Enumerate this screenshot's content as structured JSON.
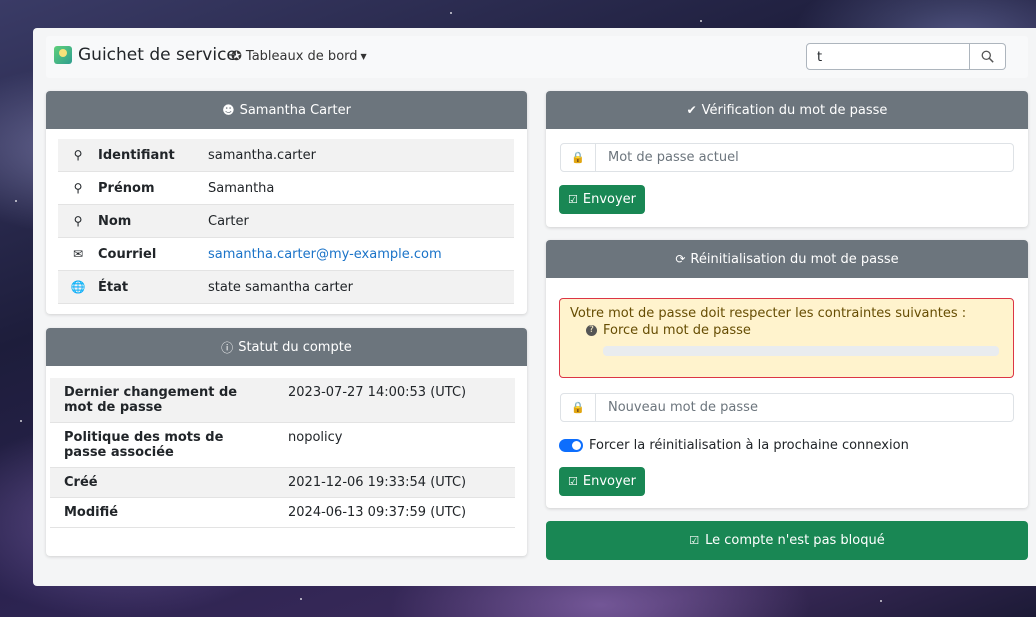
{
  "navbar": {
    "brand": "Guichet de service",
    "dashboard_label": "Tableaux de bord",
    "search_value": "t"
  },
  "user_card": {
    "title": "Samantha Carter",
    "rows": [
      {
        "icon": "user-icon",
        "label": "Identifiant",
        "value": "samantha.carter"
      },
      {
        "icon": "user-icon",
        "label": "Prénom",
        "value": "Samantha"
      },
      {
        "icon": "user-icon",
        "label": "Nom",
        "value": "Carter"
      },
      {
        "icon": "envelope-icon",
        "label": "Courriel",
        "value": "samantha.carter@my-example.com"
      },
      {
        "icon": "globe-icon",
        "label": "État",
        "value": "state samantha carter"
      }
    ]
  },
  "status_card": {
    "title": "Statut du compte",
    "rows": [
      {
        "label": "Dernier changement de mot de passe",
        "value": "2023-07-27 14:00:53 (UTC)"
      },
      {
        "label": "Politique des mots de passe associée",
        "value": "nopolicy"
      },
      {
        "label": "Créé",
        "value": "2021-12-06 19:33:54 (UTC)"
      },
      {
        "label": "Modifié",
        "value": "2024-06-13 09:37:59 (UTC)"
      }
    ]
  },
  "verify_card": {
    "title": "Vérification du mot de passe",
    "placeholder": "Mot de passe actuel",
    "submit_label": "Envoyer"
  },
  "reset_card": {
    "title": "Réinitialisation du mot de passe",
    "warning_text": "Votre mot de passe doit respecter les contraintes suivantes :",
    "rule_label": "Force du mot de passe",
    "strength_fraction": 0,
    "placeholder": "Nouveau mot de passe",
    "toggle_label": "Forcer la réinitialisation à la prochaine connexion",
    "toggle_on": true,
    "submit_label": "Envoyer"
  },
  "lock_status": {
    "label": "Le compte n'est pas bloqué"
  },
  "colors": {
    "header_gray": "#6c757d",
    "success": "#198754",
    "toggle_blue": "#0d6efd",
    "warning_bg": "#fff3cd",
    "warning_border": "#dc3545"
  }
}
